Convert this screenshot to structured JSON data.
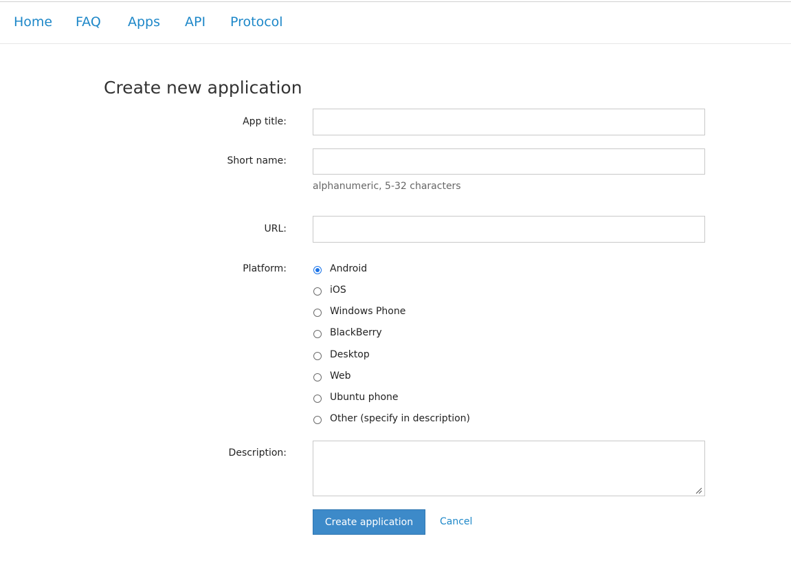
{
  "nav": {
    "items": [
      "Home",
      "FAQ",
      "Apps",
      "API",
      "Protocol"
    ]
  },
  "page": {
    "title": "Create new application"
  },
  "form": {
    "app_title": {
      "label": "App title:",
      "value": ""
    },
    "short_name": {
      "label": "Short name:",
      "value": "",
      "hint": "alphanumeric, 5-32 characters"
    },
    "url": {
      "label": "URL:",
      "value": ""
    },
    "platform": {
      "label": "Platform:",
      "selected": "Android",
      "options": [
        "Android",
        "iOS",
        "Windows Phone",
        "BlackBerry",
        "Desktop",
        "Web",
        "Ubuntu phone",
        "Other (specify in description)"
      ]
    },
    "description": {
      "label": "Description:",
      "value": ""
    },
    "submit_label": "Create application",
    "cancel_label": "Cancel"
  },
  "colors": {
    "link": "#1d87c8",
    "primary_button": "#3d8ac9",
    "radio_selected": "#1a73e8"
  }
}
